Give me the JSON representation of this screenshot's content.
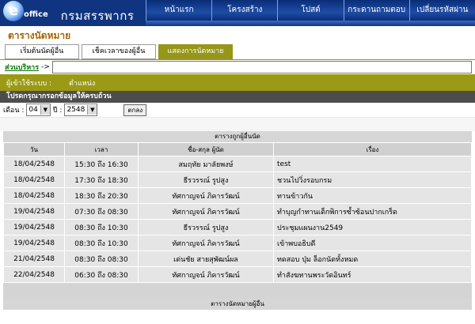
{
  "header": {
    "logo_letter": "e",
    "logo_text": "office",
    "brand": "กรมสรรพากร",
    "nav": [
      "หน้าแรก",
      "โครงสร้าง",
      "โปสต์",
      "กระดานถามตอบ",
      "เปลี่ยนรหัสผ่าน"
    ]
  },
  "section": {
    "title": "ตารางนัดหมาย",
    "tabs": [
      "เริ่มต้นนัดผู้อื่น",
      "เช็คเวลาของผู้อื่น",
      "แสดงการนัดหมาย"
    ]
  },
  "tree": {
    "link": "ส่วนบริหาร",
    "arrow": "->",
    "value": ""
  },
  "user_bar": {
    "label": "ผู้เข้าใช้ระบบ :",
    "position": "ตำแหน่ง"
  },
  "prompt": "โปรดกรุณากรอกข้อมูลให้ครบถ้วน",
  "filter": {
    "month_label": "เดือน :",
    "month": "04",
    "year_label": "ปี :",
    "year": "2548",
    "ok": "ตกลง"
  },
  "table1": {
    "title": "ตารางถูกผู้อื่นนัด",
    "headers": [
      "วัน",
      "เวลา",
      "ชื่อ-สกุล ผู้นัด",
      "เรื่อง"
    ],
    "rows": [
      [
        "18/04/2548",
        "15:30 ถึง 16:30",
        "สมฤทัย มาลัยพงษ์",
        "test"
      ],
      [
        "18/04/2548",
        "17:30 ถึง 18:30",
        "ธีรวรรณ์ รูปสูง",
        "ชวนไปวิ่งรอบกรม"
      ],
      [
        "18/04/2548",
        "18:30 ถึง 20:30",
        "ทัศกาญจน์ ภิคารวัฒน์",
        "ทานข้าวกัน"
      ],
      [
        "19/04/2548",
        "07:30 ถึง 08:30",
        "ทัศกาญจน์ ภิคารวัฒน์",
        "ทำบุญกำทานเด็กพิการซ้ำซ้อนปากเกร็ด"
      ],
      [
        "19/04/2548",
        "08:30 ถึง 10:30",
        "ธีรวรรณ์ รูปสูง",
        "ประชุมแผนงาน2549"
      ],
      [
        "19/04/2548",
        "08:30 ถึง 10:30",
        "ทัศกาญจน์ ภิคารวัฒน์",
        "เข้าพบอธิบดี"
      ],
      [
        "21/04/2548",
        "08:30 ถึง 08:30",
        "เด่นชัย สายสุพัฒน์ผล",
        "ทดสอบ ปุ่ม ล็อกนัดทั้งหมด"
      ],
      [
        "22/04/2548",
        "06:30 ถึง 08:30",
        "ทัศกาญจน์ ภิคารวัฒน์",
        "ทำสังฆทานพระวัดอินทร์"
      ]
    ]
  },
  "table2": {
    "title": "ตารางนัดหมายผู้อื่น"
  }
}
